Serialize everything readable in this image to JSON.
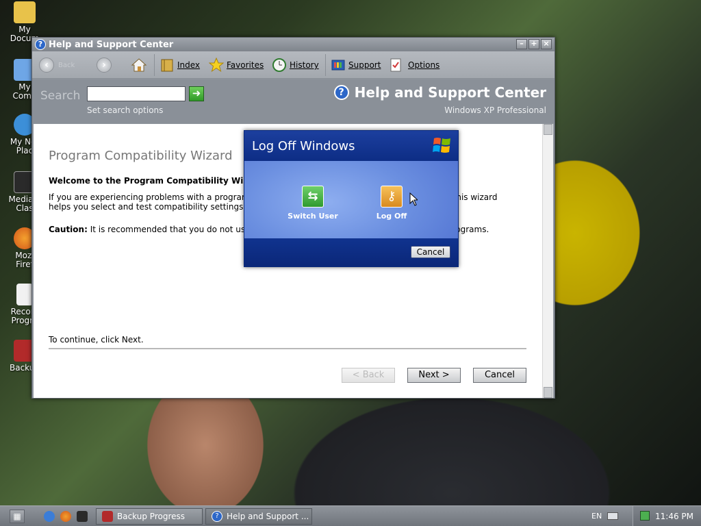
{
  "desktop": {
    "icons": [
      {
        "label": "My\nDocum",
        "icon": "folder-documents-icon",
        "color": "#e8c24a"
      },
      {
        "label": "My\nComp",
        "icon": "computer-icon",
        "color": "#6ea6e6"
      },
      {
        "label": "My Net\nPlac",
        "icon": "network-places-icon",
        "color": "#3c8fd8"
      },
      {
        "label": "Media P\nClas",
        "icon": "media-player-icon",
        "color": "#2a2a2a"
      },
      {
        "label": "Mozi\nFiref",
        "icon": "firefox-icon",
        "color": "#e76c1e"
      },
      {
        "label": "Recom\nProgra",
        "icon": "document-icon",
        "color": "#f1f1f1"
      },
      {
        "label": "Backup",
        "icon": "backup-icon",
        "color": "#b22a2a"
      }
    ]
  },
  "window": {
    "title": "Help and Support Center",
    "controls": {
      "minimize": "–",
      "maximize": "+",
      "close": "×"
    },
    "toolbar": {
      "back": "Back",
      "index": "Index",
      "favorites": "Favorites",
      "history": "History",
      "support": "Support",
      "options": "Options"
    },
    "search": {
      "label": "Search",
      "input_value": "",
      "go_glyph": "➜",
      "set_options": "Set search options"
    },
    "header": {
      "title": "Help and Support Center",
      "subtitle": "Windows XP Professional"
    }
  },
  "wizard": {
    "title": "Program Compatibility Wizard",
    "welcome": "Welcome to the Program Compatibility Wiza",
    "para1_line1_left": "If you are experiencing problems with a program",
    "para1_line1_right": ", this wizard",
    "para1_line2": "helps you select and test compatibility settings tha",
    "caution_label": "Caution:",
    "caution_text": " It is recommended that you do not use t",
    "caution_right": "programs.",
    "continue": "To continue, click Next.",
    "buttons": {
      "back": "< Back",
      "next": "Next >",
      "cancel": "Cancel"
    }
  },
  "logoff_dialog": {
    "title": "Log Off Windows",
    "switch_user": "Switch User",
    "log_off": "Log Off",
    "cancel": "Cancel",
    "colors": {
      "header": "#0d2d85",
      "body": "#6b8fe0",
      "switch_icon": "#3cab3c",
      "logoff_icon": "#e39a2d"
    }
  },
  "taskbar": {
    "tasks": [
      {
        "label": "Backup Progress",
        "icon": "backup-progress-icon"
      },
      {
        "label": "Help and Support ...",
        "icon": "help-icon"
      }
    ],
    "language": "EN",
    "time": "11:46 PM"
  }
}
